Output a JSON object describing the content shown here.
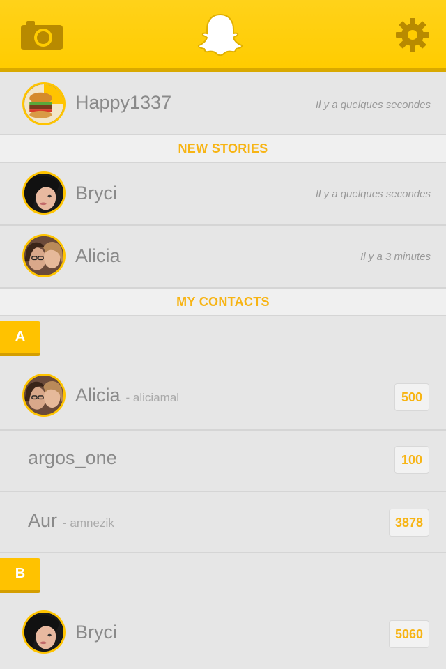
{
  "header": {
    "camera_icon": "camera-icon",
    "ghost_icon": "ghost-logo-icon",
    "settings_icon": "gear-icon",
    "accent": "#ffcc00"
  },
  "recent": [
    {
      "name": "Happy1337",
      "time": "Il y a quelques secondes"
    }
  ],
  "sections": {
    "new_stories": "NEW STORIES",
    "my_contacts": "MY CONTACTS"
  },
  "stories": [
    {
      "name": "Bryci",
      "time": "Il y a quelques secondes"
    },
    {
      "name": "Alicia",
      "time": "Il y a 3 minutes"
    }
  ],
  "letters": [
    "A",
    "B"
  ],
  "contacts": [
    {
      "name": "Alicia",
      "username": "- aliciamal",
      "score": "500"
    },
    {
      "name": "argos_one",
      "username": "",
      "score": "100"
    },
    {
      "name": "Aur",
      "username": "- amnezik",
      "score": "3878"
    },
    {
      "name": "Bryci",
      "username": "",
      "score": "5060"
    }
  ]
}
